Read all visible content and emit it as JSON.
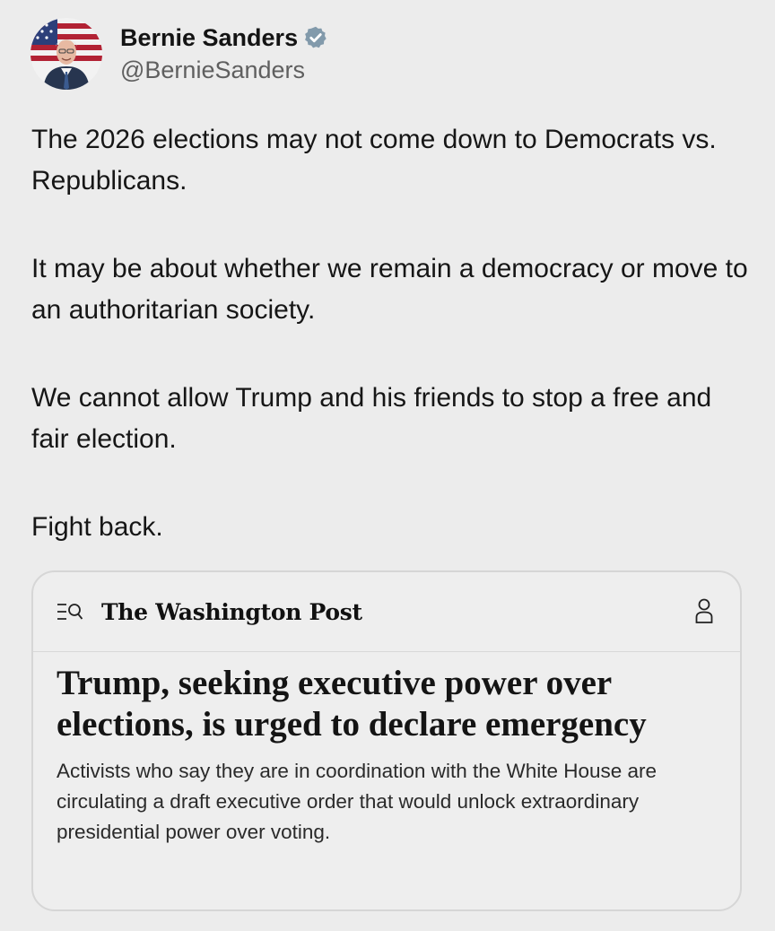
{
  "author": {
    "display_name": "Bernie Sanders",
    "handle": "@BernieSanders",
    "verified_icon": "verified-badge-icon",
    "verified_color": "#829aab"
  },
  "tweet": {
    "paragraphs": [
      "The 2026 elections may not come down to Democrats vs. Republicans.",
      "It may be about whether we remain a democracy or move to an authoritarian society.",
      "We cannot allow Trump and his friends to stop a free and fair election.",
      "Fight back."
    ]
  },
  "link_card": {
    "publication": "The Washington Post",
    "left_icon": "menu-search-icon",
    "right_icon": "user-icon",
    "headline": "Trump, seeking executive power over elections, is urged to declare emergency",
    "summary": "Activists who say they are in coordination with the White House are circulating a draft executive order that would unlock extraordinary presidential power over voting."
  }
}
